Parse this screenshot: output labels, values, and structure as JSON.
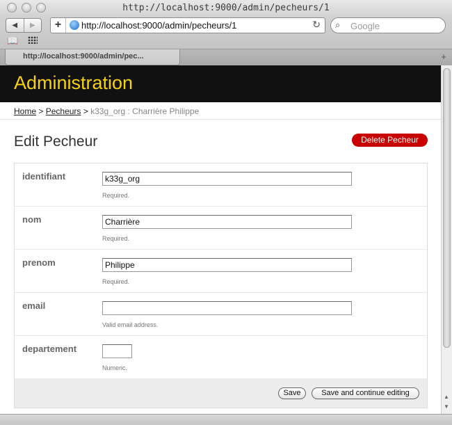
{
  "window": {
    "title": "http://localhost:9000/admin/pecheurs/1"
  },
  "toolbar": {
    "back_glyph": "◀",
    "forward_glyph": "▶",
    "new_glyph": "+",
    "url": "http://localhost:9000/admin/pecheurs/1",
    "reload_glyph": "↻",
    "search_placeholder": "Google",
    "search_glyph": "⌕",
    "bookmarks_glyph": "📖"
  },
  "tabs": [
    {
      "label": "http://localhost:9000/admin/pec..."
    }
  ],
  "tabbar": {
    "newtab_glyph": "+"
  },
  "header": {
    "title": "Administration",
    "title_color": "#f5d20b",
    "background": "#111111"
  },
  "breadcrumb": {
    "home": "Home",
    "sep1": ">",
    "section": "Pecheurs",
    "sep2": ">",
    "current": "k33g_org : Charrière Philippe"
  },
  "page": {
    "title": "Edit Pecheur",
    "delete_label": "Delete Pecheur",
    "delete_color": "#c80000"
  },
  "form": {
    "fields": [
      {
        "label": "identifiant",
        "value": "k33g_org",
        "help": "Required."
      },
      {
        "label": "nom",
        "value": "Charrière",
        "help": "Required."
      },
      {
        "label": "prenom",
        "value": "Philippe",
        "help": "Required."
      },
      {
        "label": "email",
        "value": "",
        "help": "Valid email address."
      },
      {
        "label": "departement",
        "value": "",
        "help": "Numeric."
      }
    ],
    "save_label": "Save",
    "save_continue_label": "Save and continue editing"
  },
  "scrollbar": {
    "up_glyph": "▲",
    "down_glyph": "▼"
  }
}
